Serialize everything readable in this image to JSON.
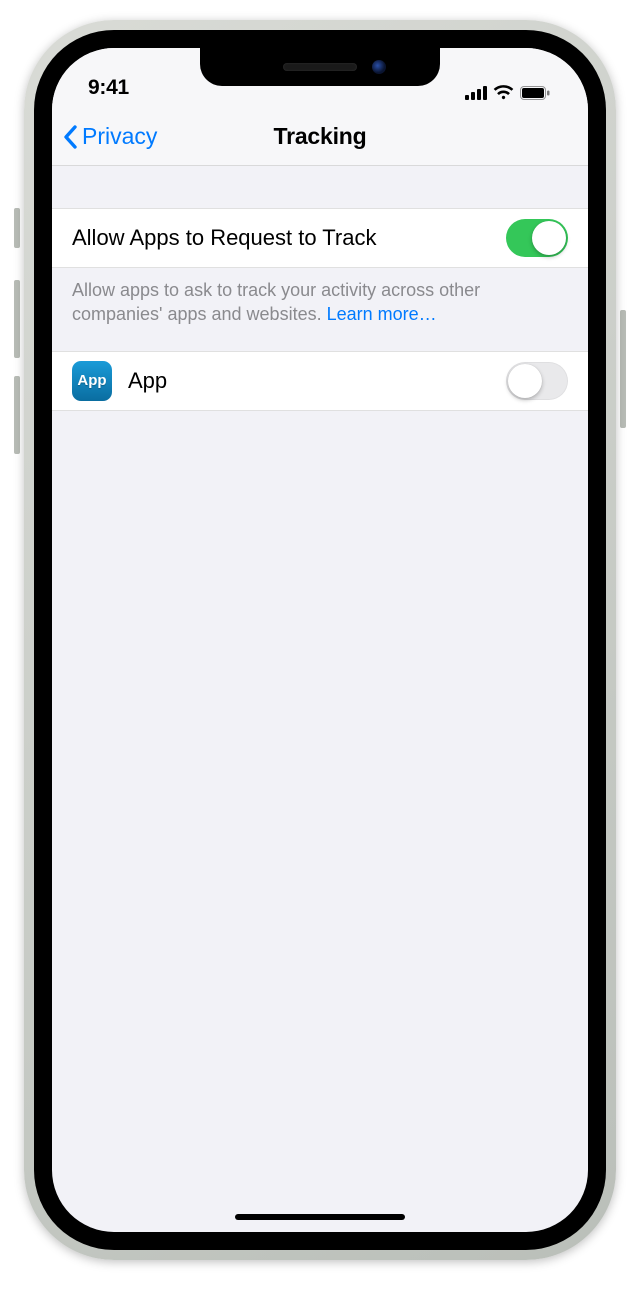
{
  "status": {
    "time": "9:41"
  },
  "nav": {
    "back_label": "Privacy",
    "title": "Tracking"
  },
  "allow_row": {
    "label": "Allow Apps to Request to Track",
    "on": true
  },
  "footnote": {
    "text": "Allow apps to ask to track your activity across other companies' apps and websites. ",
    "link": "Learn more…"
  },
  "apps": [
    {
      "icon_text": "App",
      "name": "App",
      "on": false
    }
  ],
  "colors": {
    "link": "#007aff",
    "toggle_on": "#34c759"
  }
}
